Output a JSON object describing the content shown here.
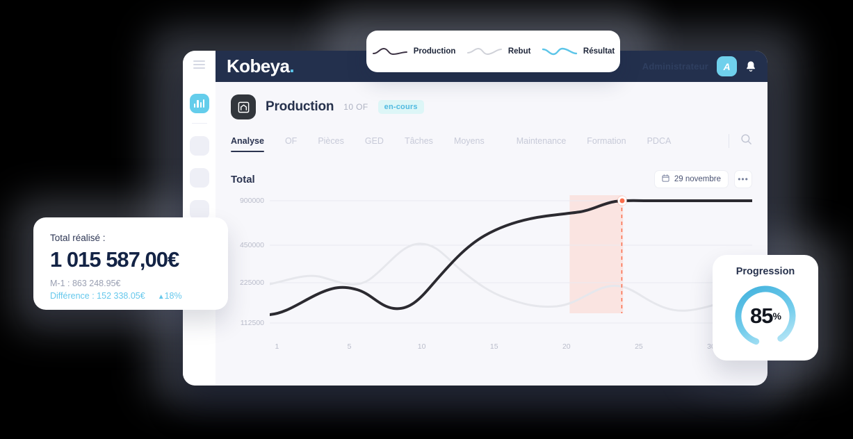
{
  "header": {
    "logo": "Kobeya",
    "logo_dot": ".",
    "username": "Administrateur",
    "avatar_initial": "A",
    "menu_icon": "hamburger-icon",
    "bell_icon": "bell-icon"
  },
  "sidebar": {
    "items": [
      {
        "icon": "bar-chart-icon",
        "active": true
      },
      {
        "icon": "placeholder-icon",
        "active": false
      },
      {
        "icon": "placeholder-icon",
        "active": false
      },
      {
        "icon": "placeholder-icon",
        "active": false
      },
      {
        "icon": "placeholder-icon",
        "active": false
      }
    ]
  },
  "page": {
    "icon": "factory-icon",
    "title": "Production",
    "of_count": "10 OF",
    "status_badge": "en-cours"
  },
  "tabs": [
    {
      "label": "Analyse",
      "active": true
    },
    {
      "label": "OF",
      "active": false
    },
    {
      "label": "Pièces",
      "active": false
    },
    {
      "label": "GED",
      "active": false
    },
    {
      "label": "Tâches",
      "active": false
    },
    {
      "label": "Moyens",
      "active": false
    },
    {
      "label": "Maintenance",
      "active": false
    },
    {
      "label": "Formation",
      "active": false
    },
    {
      "label": "PDCA",
      "active": false
    }
  ],
  "tabs_right": {
    "search_icon": "search-icon"
  },
  "panel": {
    "title": "Total",
    "date_label": "29 novembre",
    "calendar_icon": "calendar-icon",
    "more_label": "•••"
  },
  "legend": [
    {
      "label": "Production",
      "color": "#3b3142"
    },
    {
      "label": "Rebut",
      "color": "#cfd1d8"
    },
    {
      "label": "Résultat",
      "color": "#5cc5e8"
    }
  ],
  "kpi": {
    "label": "Total réalisé :",
    "value": "1 015 587,00€",
    "previous": "M-1 : 863 248.95€",
    "difference": "Différence : 152 338.05€",
    "trend_arrow": "▲",
    "trend_value": "18%",
    "accent_color": "#66c8ec"
  },
  "progression": {
    "title": "Progression",
    "value": "85",
    "unit": "%",
    "percent": 85,
    "ring_color_start": "#4fb6dd",
    "ring_color_end": "#bfe9f6"
  },
  "chart_data": {
    "type": "line",
    "title": "Total",
    "xlabel": "",
    "ylabel": "",
    "x": [
      1,
      5,
      10,
      15,
      20,
      25,
      30
    ],
    "xticks": [
      "1",
      "5",
      "10",
      "15",
      "20",
      "25",
      "30"
    ],
    "yticks": [
      "900000",
      "450000",
      "225000",
      "112500"
    ],
    "ytick_values": [
      900000,
      450000,
      225000,
      112500
    ],
    "ylim": [
      112500,
      900000
    ],
    "grid": true,
    "legend_position": "top-floating",
    "series": [
      {
        "name": "Production",
        "color": "#2b2a30",
        "values": [
          120000,
          180000,
          165000,
          150000,
          230000,
          420000,
          600000,
          790000,
          860000,
          900000,
          900000,
          900000
        ]
      },
      {
        "name": "Rebut",
        "color": "#e4e5ea",
        "values": [
          240000,
          215000,
          330000,
          400000,
          330000,
          250000,
          195000,
          170000,
          260000,
          300000,
          215000,
          200000
        ]
      },
      {
        "name": "Résultat",
        "color": "#5cc5e8",
        "values": []
      }
    ],
    "highlight_band": {
      "from": 20,
      "to": 24,
      "color": "#fae3e0"
    },
    "marker": {
      "x": 23,
      "y": 900000,
      "color": "#fb6d4c",
      "dashed_line": true
    }
  }
}
